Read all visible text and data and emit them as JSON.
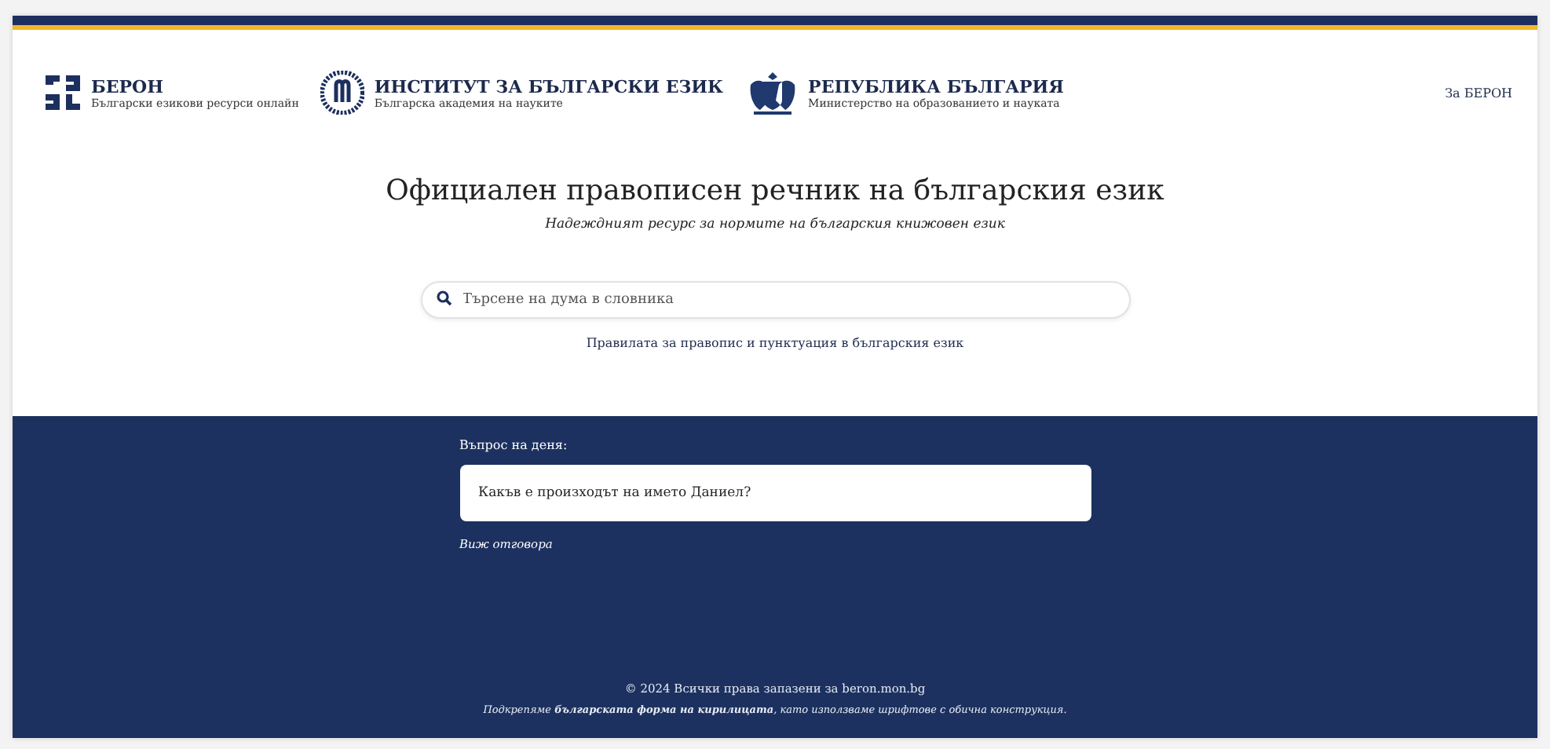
{
  "header": {
    "logos": [
      {
        "kind": "beron",
        "title": "БЕРОН",
        "subtitle": "Български езикови ресурси онлайн"
      },
      {
        "kind": "ibe",
        "title": "ИНСТИТУТ ЗА БЪЛГАРСКИ ЕЗИК",
        "subtitle": "Българска академия на науките"
      },
      {
        "kind": "crest",
        "title": "РЕПУБЛИКА БЪЛГАРИЯ",
        "subtitle": "Министерство на образованието и науката"
      }
    ],
    "nav_link": "За БЕРОН"
  },
  "hero": {
    "title": "Официален правописен речник на българския език",
    "subtitle": "Надеждният ресурс за нормите на българския книжовен език",
    "search": {
      "placeholder": "Търсене на дума в словника"
    },
    "rules_link": "Правилата за правопис и пунктуация в българския език"
  },
  "question": {
    "label": "Въпрос на деня:",
    "text": "Какъв е произходът на името Даниел?",
    "answer_link": "Виж отговора"
  },
  "footer": {
    "copyright": "© 2024 Всички права запазени за beron.mon.bg",
    "note": "Подкрепяме **българската форма на кирилицата**, като използваме шрифтове с обична конструкция."
  }
}
